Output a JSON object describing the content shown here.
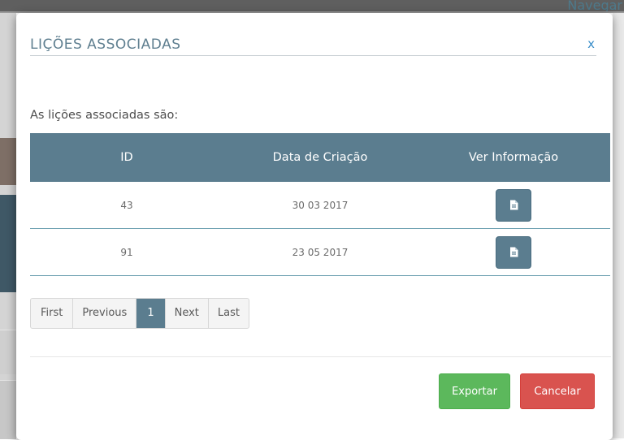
{
  "background": {
    "nav_label": "Navegar"
  },
  "modal": {
    "title": "LIÇÕES ASSOCIADAS",
    "close_label": "x",
    "intro": "As lições associadas são:",
    "table": {
      "headers": [
        "ID",
        "Data de Criação",
        "Ver Informação"
      ],
      "rows": [
        {
          "id": "43",
          "date": "30 03 2017",
          "action_icon": "document-icon"
        },
        {
          "id": "91",
          "date": "23 05 2017",
          "action_icon": "document-icon"
        }
      ]
    },
    "pagination": {
      "first": "First",
      "previous": "Previous",
      "current": "1",
      "next": "Next",
      "last": "Last"
    },
    "buttons": {
      "export": "Exportar",
      "cancel": "Cancelar"
    }
  },
  "colors": {
    "header_bg": "#5b7d8f",
    "title": "#5f7f90",
    "close": "#3a8ec9",
    "export": "#5cb85c",
    "cancel": "#d9534f"
  }
}
